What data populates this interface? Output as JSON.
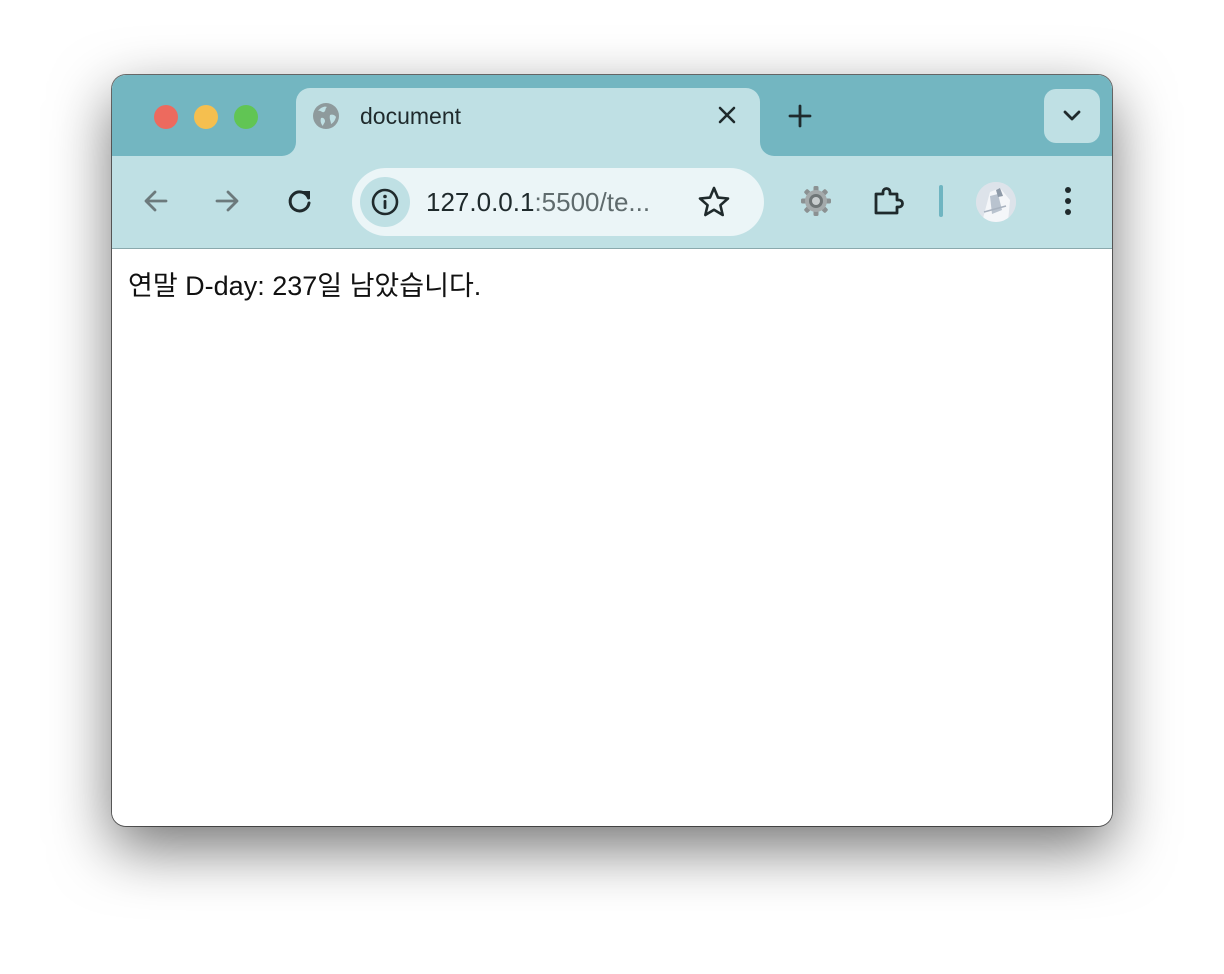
{
  "browser": {
    "tab": {
      "title": "document",
      "favicon": "globe-icon"
    },
    "toolbar": {
      "back_icon": "arrow-left-icon",
      "forward_icon": "arrow-right-icon",
      "reload_icon": "reload-icon",
      "address": {
        "host": "127.0.0.1",
        "rest": ":5500/te..."
      },
      "bookmark_icon": "star-icon",
      "extension_icons": [
        "gear-icon",
        "puzzle-icon"
      ],
      "menu_icon": "more-vertical-icon"
    },
    "colors": {
      "titlebar": "#73b6c1",
      "tab_active": "#bfe0e4",
      "toolbar": "#bfe0e4",
      "omnibox": "#ebf5f7"
    }
  },
  "page": {
    "text": "연말 D-day: 237일 남았습니다."
  }
}
